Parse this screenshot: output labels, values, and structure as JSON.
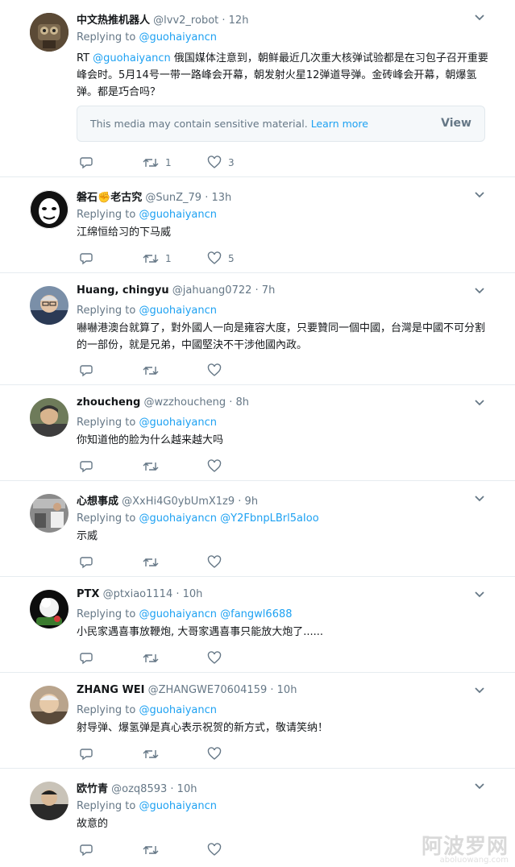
{
  "tweets": [
    {
      "name": "中文热推机器人",
      "handle": "@lvv2_robot",
      "time": "· 12h",
      "replying_prefix": "Replying to ",
      "replying_to": "@guohaiyancn",
      "text_prefix": "RT ",
      "text_mention": "@guohaiyancn",
      "text": " 俄国媒体注意到，朝鲜最近几次重大核弹试验都是在习包子召开重要峰会时。5月14号一带一路峰会开幕，朝发射火星12弹道导弹。金砖峰会开幕，朝爆氢弹。都是巧合吗？",
      "media_notice": "This media may contain sensitive material.",
      "media_learn_more": "Learn more",
      "media_view": "View",
      "retweets": "1",
      "likes": "3"
    },
    {
      "name": "磐石",
      "name_emoji": "✊",
      "name_suffix": "老古究",
      "handle": "@SunZ_79",
      "time": "· 13h",
      "replying_prefix": "Replying to ",
      "replying_to": "@guohaiyancn",
      "text": "江绵恒给习的下马威",
      "retweets": "1",
      "likes": "5"
    },
    {
      "name": "Huang, chingyu",
      "handle": "@jahuang0722",
      "time": "· 7h",
      "replying_prefix": "Replying to ",
      "replying_to": "@guohaiyancn",
      "text": "嚇嚇港澳台就算了，對外國人一向是雍容大度，只要贊同一個中國，台灣是中國不可分割的一部份，就是兄弟，中國堅決不干涉他國內政。"
    },
    {
      "name": "zhoucheng",
      "handle": "@wzzhoucheng",
      "time": "· 8h",
      "replying_prefix": "Replying to ",
      "replying_to": "@guohaiyancn",
      "text": "你知道他的脸为什么越来越大吗"
    },
    {
      "name": "心想事成",
      "handle": "@XxHi4G0ybUmX1z9",
      "time": "· 9h",
      "replying_prefix": "Replying to ",
      "replying_to": "@guohaiyancn",
      "replying_to_2": "@Y2FbnpLBrl5aIoo",
      "text": "示威"
    },
    {
      "name": "PTX",
      "handle": "@ptxiao1114",
      "time": "· 10h",
      "replying_prefix": "Replying to ",
      "replying_to": "@guohaiyancn",
      "replying_to_2": "@fangwl6688",
      "text": "小民家遇喜事放鞭炮, 大哥家遇喜事只能放大炮了......"
    },
    {
      "name": "ZHANG WEI",
      "handle": "@ZHANGWE70604159",
      "time": "· 10h",
      "replying_prefix": "Replying to ",
      "replying_to": "@guohaiyancn",
      "text": "射导弹、爆氢弹是真心表示祝贺的新方式，敬请笑纳！"
    },
    {
      "name": "欧竹青",
      "handle": "@ozq8593",
      "time": "· 10h",
      "replying_prefix": "Replying to ",
      "replying_to": "@guohaiyancn",
      "text": "故意的"
    }
  ],
  "watermark": {
    "cn": "阿波罗网",
    "url": "aboluowang.com"
  },
  "colors": {
    "link": "#1da1f2",
    "secondary": "#657786",
    "border": "#e6ecf0"
  }
}
